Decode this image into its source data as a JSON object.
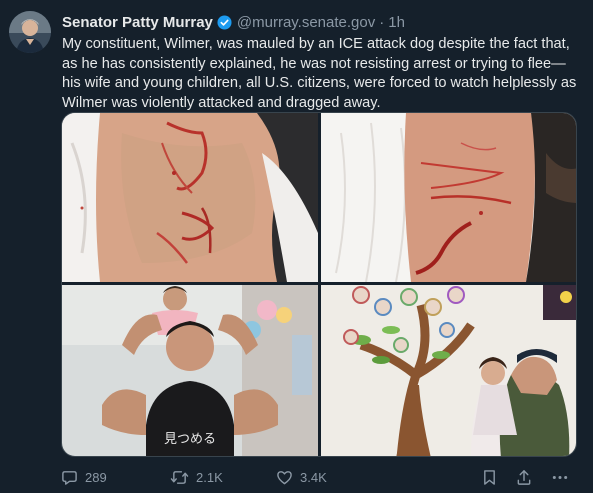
{
  "post": {
    "author_name": "Senator Patty Murray",
    "handle": "@murray.senate.gov",
    "separator": "·",
    "time": "1h",
    "text": "My constituent, Wilmer, was mauled by an ICE attack dog despite the fact that, as he has consistently explained, he was not resisting arrest or trying to flee—his wife and young children, all U.S. citizens, were forced to watch helplessly as Wilmer was violently attacked and dragged away.",
    "shirt_text": "見つめる"
  },
  "actions": {
    "reply_count": "289",
    "repost_count": "2.1K",
    "like_count": "3.4K"
  },
  "icons": {
    "verified": "verified-badge-icon",
    "reply": "reply-icon",
    "repost": "repost-icon",
    "like": "heart-icon",
    "bookmark": "bookmark-icon",
    "share": "share-icon",
    "more": "more-icon"
  },
  "colors": {
    "background": "#15202b",
    "text": "#e7e9ea",
    "secondary": "#8b98a5",
    "verified": "#1d9bf0"
  }
}
